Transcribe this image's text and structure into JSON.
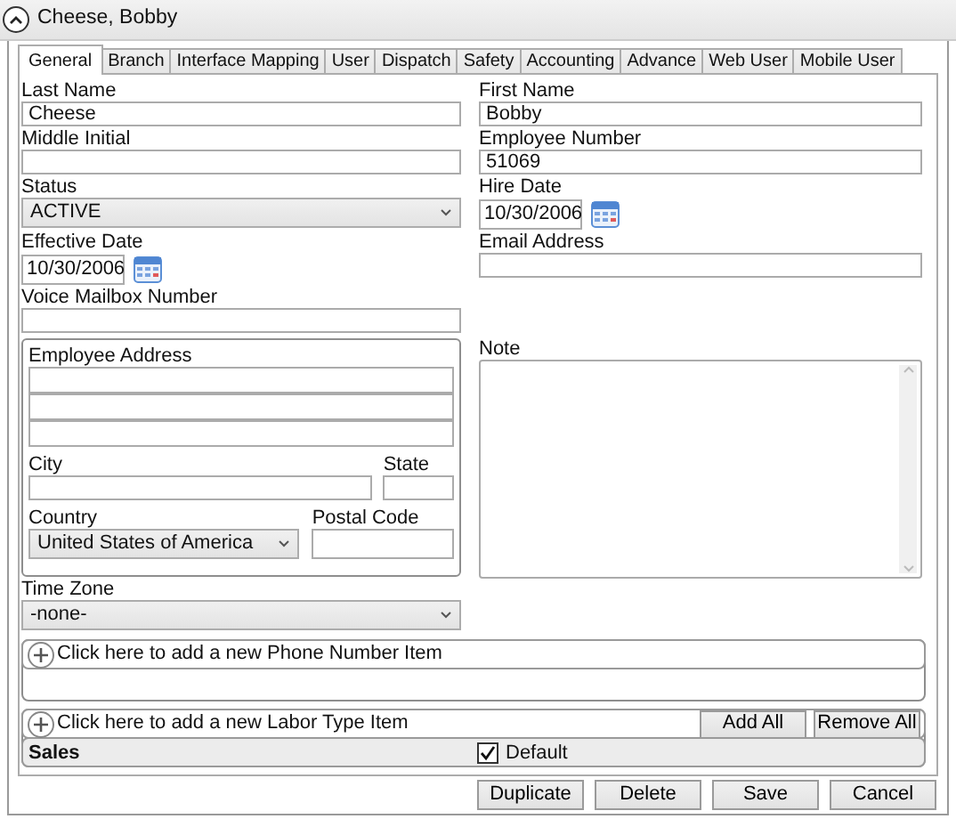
{
  "header": {
    "title": "Cheese, Bobby",
    "expanded": true
  },
  "tabs": [
    {
      "label": "General",
      "selected": true
    },
    {
      "label": "Branch",
      "selected": false
    },
    {
      "label": "Interface Mapping",
      "selected": false
    },
    {
      "label": "User",
      "selected": false
    },
    {
      "label": "Dispatch",
      "selected": false
    },
    {
      "label": "Safety",
      "selected": false
    },
    {
      "label": "Accounting",
      "selected": false
    },
    {
      "label": "Advance",
      "selected": false
    },
    {
      "label": "Web User",
      "selected": false
    },
    {
      "label": "Mobile User",
      "selected": false
    }
  ],
  "rows": [
    {
      "left": {
        "label": "Last Name",
        "kind": "text",
        "value": "Cheese"
      },
      "right": {
        "label": "First Name",
        "kind": "text",
        "value": "Bobby"
      }
    },
    {
      "left": {
        "label": "Middle Initial",
        "kind": "text"
      },
      "right": {
        "label": "Employee Number",
        "kind": "text",
        "value": "51069"
      }
    },
    {
      "left": {
        "label": "Status",
        "kind": "select",
        "value": "ACTIVE"
      },
      "right": {
        "label": "Hire Date",
        "kind": "date",
        "value": "10/30/2006"
      }
    },
    {
      "left": {
        "label": "Effective Date",
        "kind": "date",
        "value": "10/30/2006"
      },
      "right": {
        "label": "Email Address",
        "kind": "text"
      }
    },
    {
      "left": {
        "label": "Voice Mailbox Number",
        "kind": "text"
      }
    }
  ],
  "address": {
    "title": "Employee Address",
    "city_label": "City",
    "state_label": "State",
    "country_label": "Country",
    "country_value": "United States of America",
    "postal_label": "Postal Code"
  },
  "note": {
    "label": "Note"
  },
  "time_zone": {
    "label": "Time Zone",
    "value": "-none-"
  },
  "phone_numbers": {
    "add_text": "Click here to add a new Phone Number Item"
  },
  "labor_types": {
    "add_text": "Click here to add a new Labor Type Item",
    "buttons": [
      "Add All",
      "Remove All"
    ],
    "rows": [
      {
        "name": "Sales",
        "default_label": "Default",
        "checked": true
      }
    ]
  },
  "footer_buttons": [
    "Duplicate",
    "Delete",
    "Save",
    "Cancel"
  ]
}
